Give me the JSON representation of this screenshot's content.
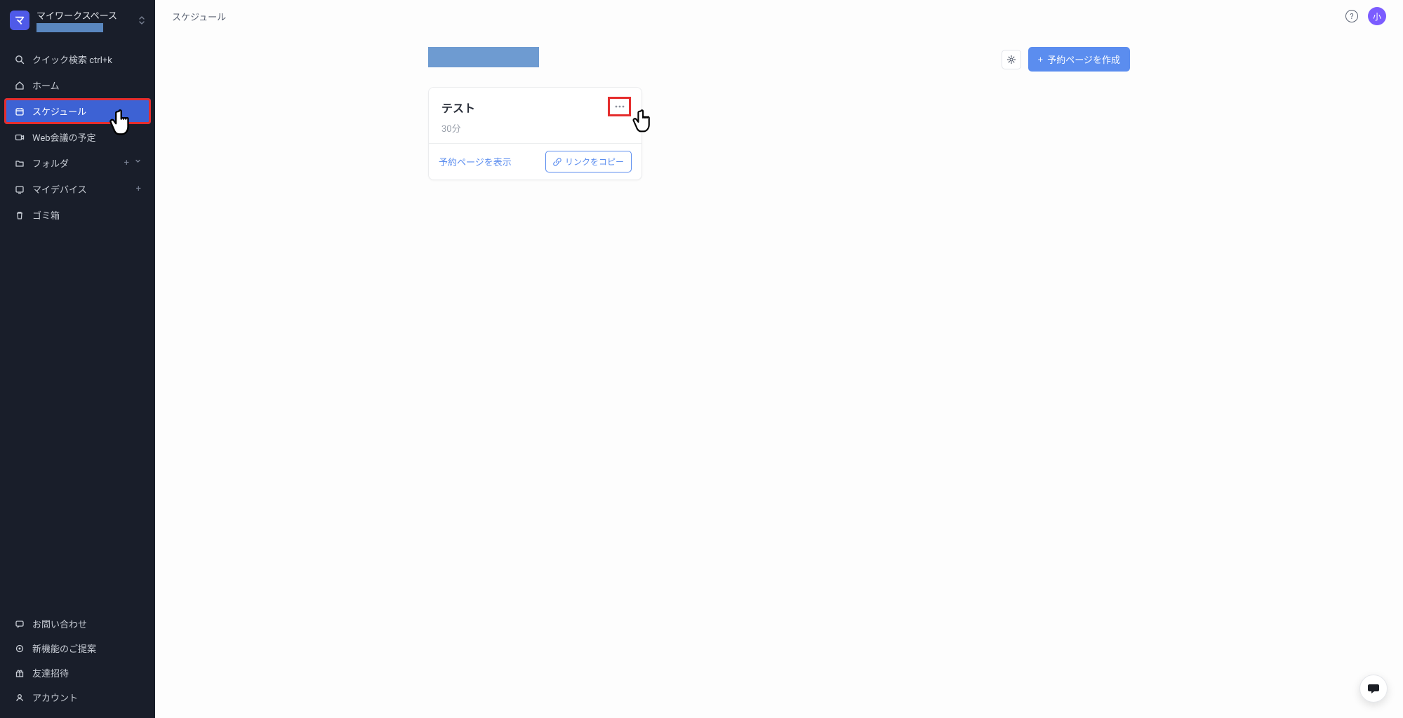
{
  "workspace": {
    "badge": "マ",
    "name": "マイワークスペース"
  },
  "nav": {
    "search": "クイック検索 ctrl+k",
    "home": "ホーム",
    "schedule": "スケジュール",
    "webMeeting": "Web会議の予定",
    "folder": "フォルダ",
    "myDevice": "マイデバイス",
    "trash": "ゴミ箱"
  },
  "footer": {
    "contact": "お問い合わせ",
    "newFeatures": "新機能のご提案",
    "inviteFriends": "友達招待",
    "account": "アカウント"
  },
  "topbar": {
    "breadcrumb": "スケジュール",
    "avatar": "小"
  },
  "actions": {
    "createPage": "予約ページを作成"
  },
  "card": {
    "title": "テスト",
    "duration": "30分",
    "viewPage": "予約ページを表示",
    "copyLink": "リンクをコピー"
  }
}
